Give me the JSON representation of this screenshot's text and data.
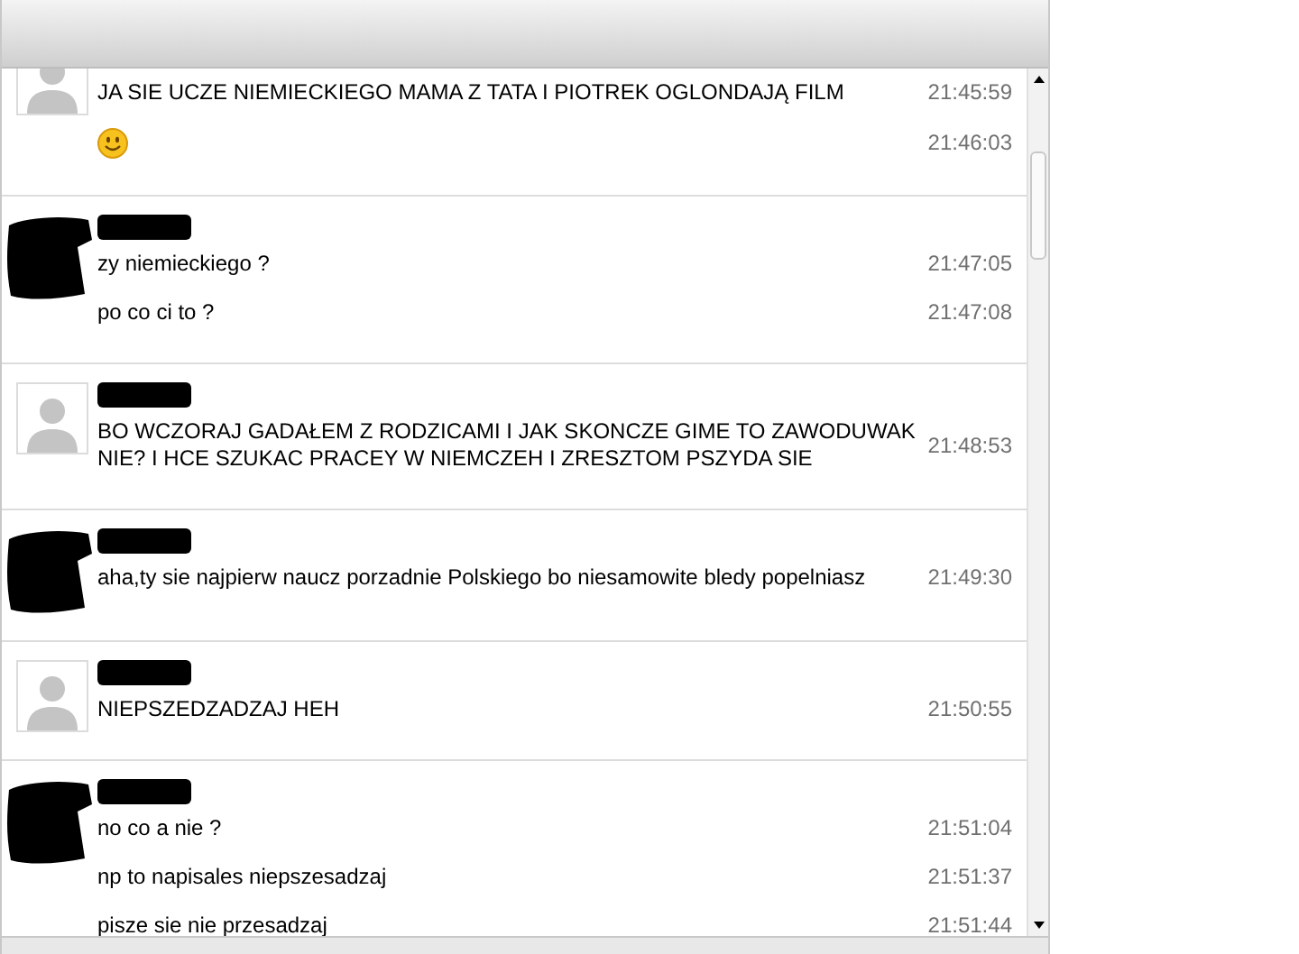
{
  "messages": [
    {
      "avatar_redacted": false,
      "lines": [
        {
          "kind": "text",
          "text": "JA SIE UCZE NIEMIECKIEGO MAMA Z TATA I PIOTREK OGLONDAJĄ FILM",
          "time": "21:45:59"
        },
        {
          "kind": "emoji",
          "time": "21:46:03"
        }
      ]
    },
    {
      "avatar_redacted": true,
      "lines": [
        {
          "kind": "text",
          "text": "zy niemieckiego ?",
          "time": "21:47:05"
        },
        {
          "kind": "text",
          "text": "po co ci to ?",
          "time": "21:47:08"
        }
      ]
    },
    {
      "avatar_redacted": false,
      "lines": [
        {
          "kind": "text",
          "text": "BO WCZORAJ GADAŁEM Z RODZICAMI I JAK SKONCZE GIME TO ZAWODUWAK NIE? I HCE SZUKAC PRACEY W NIEMCZEH I ZRESZTOM PSZYDA SIE",
          "time": "21:48:53"
        }
      ]
    },
    {
      "avatar_redacted": true,
      "lines": [
        {
          "kind": "text",
          "text": "aha,ty sie najpierw naucz porzadnie Polskiego bo niesamowite bledy popelniasz",
          "time": "21:49:30"
        }
      ]
    },
    {
      "avatar_redacted": false,
      "lines": [
        {
          "kind": "text",
          "text": "NIEPSZEDZADZAJ HEH",
          "time": "21:50:55"
        }
      ]
    },
    {
      "avatar_redacted": true,
      "lines": [
        {
          "kind": "text",
          "text": "no co a nie ?",
          "time": "21:51:04"
        },
        {
          "kind": "text",
          "text": "np to napisales niepszesadzaj",
          "time": "21:51:37"
        },
        {
          "kind": "text",
          "text": "pisze sie nie przesadzaj",
          "time": "21:51:44"
        }
      ]
    }
  ]
}
